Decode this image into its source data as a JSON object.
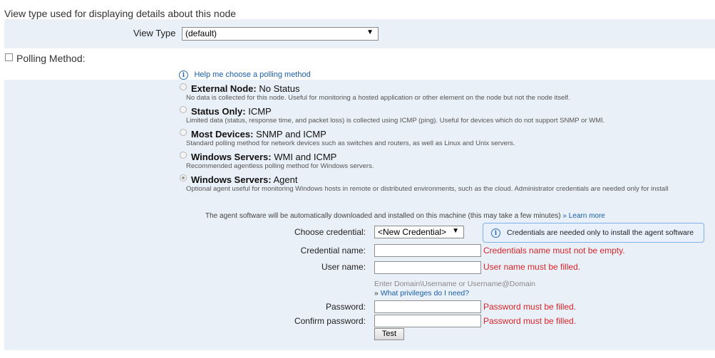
{
  "view_section": {
    "heading": "View type used for displaying details about this node",
    "label": "View Type",
    "selected": "(default)"
  },
  "polling": {
    "label": "Polling Method:",
    "help_link": "Help me choose a polling method",
    "options": [
      {
        "bold": "External Node:",
        "rest": "No Status",
        "desc": "No data is collected for this node. Useful for monitoring a hosted application or other element on the node but not the node itself.",
        "selected": false
      },
      {
        "bold": "Status Only:",
        "rest": "ICMP",
        "desc": "Limited data (status, response time, and packet loss) is collected using ICMP (ping). Useful for devices which do not support SNMP or WMI.",
        "selected": false
      },
      {
        "bold": "Most Devices:",
        "rest": "SNMP and ICMP",
        "desc": "Standard polling method for network devices such as switches and routers, as well as Linux and Unix servers.",
        "selected": false
      },
      {
        "bold": "Windows Servers:",
        "rest": "WMI and ICMP",
        "desc": "Recommended agentless polling method for Windows servers.",
        "selected": false
      },
      {
        "bold": "Windows Servers:",
        "rest": "Agent",
        "desc": "Optional agent useful for monitoring Windows hosts in remote or distributed environments, such as the cloud. Administrator credentials are needed only for install",
        "selected": true
      }
    ]
  },
  "agent": {
    "note": "The agent software will be automatically downloaded and installed on this machine (this may take a few minutes)",
    "note_link": "» Learn more",
    "choose_credential_label": "Choose credential:",
    "credential_selected": "<New Credential>",
    "callout": "Credentials are needed only to install the agent software",
    "credential_name_label": "Credential name:",
    "credential_name_error": "Credentials name must not be empty.",
    "user_name_label": "User name:",
    "user_name_error": "User name must be filled.",
    "user_hint": "Enter Domain\\Username or Username@Domain",
    "privileges_link": "What privileges do I need?",
    "privileges_prefix": "»",
    "password_label": "Password:",
    "password_error": "Password must be filled.",
    "confirm_label": "Confirm password:",
    "confirm_error": "Password must be filled.",
    "test_button": "Test"
  },
  "icons": {
    "info": "info-icon",
    "dropdown": "chevron-down-icon"
  },
  "colors": {
    "band": "#e9f0f7",
    "error": "#d8242a",
    "link": "#1a5ea8"
  }
}
